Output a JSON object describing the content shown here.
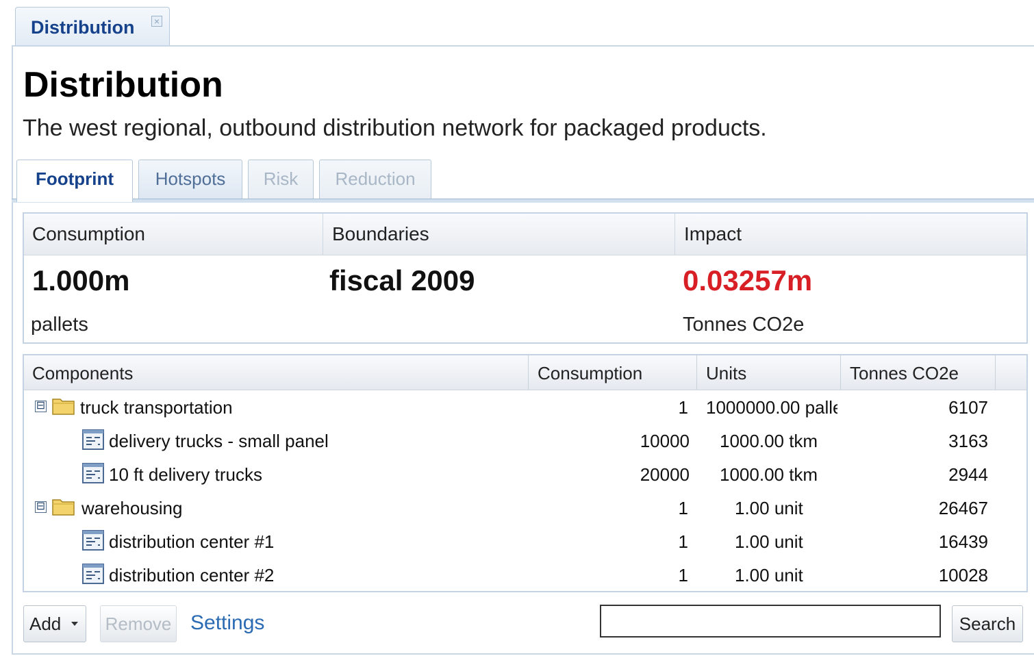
{
  "tab": {
    "label": "Distribution",
    "close_glyph": "×"
  },
  "page": {
    "title": "Distribution",
    "description": "The west regional, outbound distribution network for packaged products."
  },
  "tabs": [
    {
      "label": "Footprint",
      "state": "active"
    },
    {
      "label": "Hotspots",
      "state": "inactive"
    },
    {
      "label": "Risk",
      "state": "disabled"
    },
    {
      "label": "Reduction",
      "state": "disabled"
    }
  ],
  "summary": {
    "consumption": {
      "header": "Consumption",
      "value": "1.000m",
      "unit": "pallets"
    },
    "boundaries": {
      "header": "Boundaries",
      "value": "fiscal 2009"
    },
    "impact": {
      "header": "Impact",
      "value": "0.03257m",
      "unit": "Tonnes CO2e",
      "color": "#d81f26"
    }
  },
  "grid": {
    "columns": [
      "Components",
      "Consumption",
      "Units",
      "Tonnes CO2e"
    ],
    "rows": [
      {
        "name": "truck transportation",
        "consumption": "1",
        "units": "1000000.00 palle",
        "tonnes": "6107",
        "type": "folder",
        "expanded": "⊟"
      },
      {
        "name": "delivery trucks - small panel",
        "consumption": "10000",
        "units": "1000.00 tkm",
        "tonnes": "3163",
        "type": "item"
      },
      {
        "name": "10 ft delivery trucks",
        "consumption": "20000",
        "units": "1000.00 tkm",
        "tonnes": "2944",
        "type": "item"
      },
      {
        "name": "warehousing",
        "consumption": "1",
        "units": "1.00 unit",
        "tonnes": "26467",
        "type": "folder",
        "expanded": "⊟"
      },
      {
        "name": "distribution center #1",
        "consumption": "1",
        "units": "1.00 unit",
        "tonnes": "16439",
        "type": "item"
      },
      {
        "name": "distribution center #2",
        "consumption": "1",
        "units": "1.00 unit",
        "tonnes": "10028",
        "type": "item"
      }
    ]
  },
  "toolbar": {
    "add_label": "Add",
    "remove_label": "Remove",
    "settings_label": "Settings",
    "search_value": "",
    "search_label": "Search"
  },
  "icons": {
    "folder": "folder-icon",
    "item": "component-icon",
    "dropdown": "dropdown-arrow-icon"
  }
}
